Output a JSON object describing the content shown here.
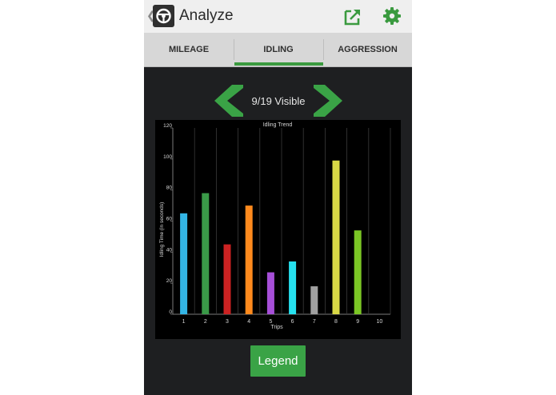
{
  "actionbar": {
    "title": "Analyze",
    "back_icon": "back-caret-icon",
    "app_icon": "steering-wheel-icon",
    "share_icon": "share-icon",
    "settings_icon": "gear-icon"
  },
  "tabs": [
    {
      "label": "MILEAGE",
      "selected": false
    },
    {
      "label": "IDLING",
      "selected": true
    },
    {
      "label": "AGGRESSION",
      "selected": false
    }
  ],
  "pager": {
    "text": "9/19 Visible",
    "prev_icon": "chevron-left-icon",
    "next_icon": "chevron-right-icon"
  },
  "legend_button": "Legend",
  "colors": {
    "accent": "#3a9a3f",
    "chart_bg": "#000000",
    "screen_bg": "#1e1f21"
  },
  "chart_data": {
    "type": "bar",
    "title": "Idling Trend",
    "xlabel": "Trips",
    "ylabel": "Idling Time (in seconds)",
    "categories": [
      "1",
      "2",
      "3",
      "4",
      "5",
      "6",
      "7",
      "8",
      "9",
      "10"
    ],
    "values": [
      65,
      78,
      45,
      70,
      27,
      34,
      18,
      99,
      54,
      null
    ],
    "colors": [
      "#33b5e5",
      "#3a9a48",
      "#cc2222",
      "#ff8a1d",
      "#a64fd8",
      "#26e1ef",
      "#a0a0a0",
      "#d8d846",
      "#7bc625",
      null
    ],
    "yticks": [
      0,
      20,
      40,
      60,
      80,
      100,
      120
    ],
    "ylim": [
      0,
      120
    ],
    "grid": "vertical"
  }
}
